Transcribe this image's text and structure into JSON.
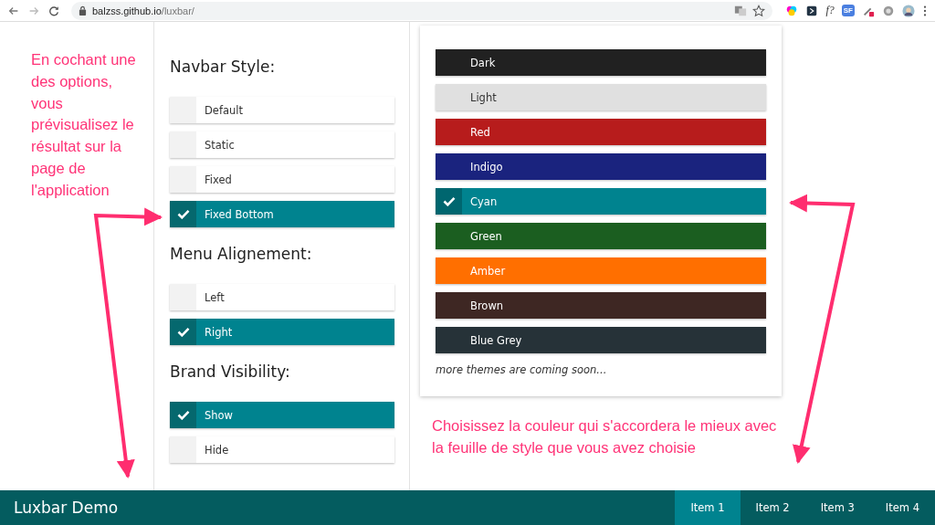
{
  "browser": {
    "url_host": "balzss.github.io",
    "url_path": "/luxbar/",
    "extension_labels": [
      "f?",
      "SF"
    ]
  },
  "annotations": {
    "left": "En cochant une des options, vous prévisualisez le résultat sur la page de l'application",
    "bottom": "Choisissez la couleur qui s'accordera le mieux avec la feuille de style que vous avez choisie"
  },
  "sections": [
    {
      "title": "Navbar Style:",
      "options": [
        {
          "label": "Default",
          "selected": false
        },
        {
          "label": "Static",
          "selected": false
        },
        {
          "label": "Fixed",
          "selected": false
        },
        {
          "label": "Fixed Bottom",
          "selected": true
        }
      ]
    },
    {
      "title": "Menu Alignement:",
      "options": [
        {
          "label": "Left",
          "selected": false
        },
        {
          "label": "Right",
          "selected": true
        }
      ]
    },
    {
      "title": "Brand Visibility:",
      "options": [
        {
          "label": "Show",
          "selected": true
        },
        {
          "label": "Hide",
          "selected": false
        }
      ]
    }
  ],
  "themes": [
    {
      "label": "Dark",
      "color": "#212121",
      "selected": false
    },
    {
      "label": "Light",
      "color": "#e0e0e0",
      "selected": false
    },
    {
      "label": "Red",
      "color": "#b71c1c",
      "selected": false
    },
    {
      "label": "Indigo",
      "color": "#1a237e",
      "selected": false
    },
    {
      "label": "Cyan",
      "color": "#00838f",
      "selected": true
    },
    {
      "label": "Green",
      "color": "#1b5e20",
      "selected": false
    },
    {
      "label": "Amber",
      "color": "#ff6f00",
      "selected": false
    },
    {
      "label": "Brown",
      "color": "#3e2723",
      "selected": false
    },
    {
      "label": "Blue Grey",
      "color": "#263238",
      "selected": false
    }
  ],
  "themes_note": "more themes are coming soon...",
  "navbar": {
    "brand": "Luxbar Demo",
    "items": [
      {
        "label": "Item 1",
        "selected": true
      },
      {
        "label": "Item 2",
        "selected": false
      },
      {
        "label": "Item 3",
        "selected": false
      },
      {
        "label": "Item 4",
        "selected": false
      }
    ]
  }
}
